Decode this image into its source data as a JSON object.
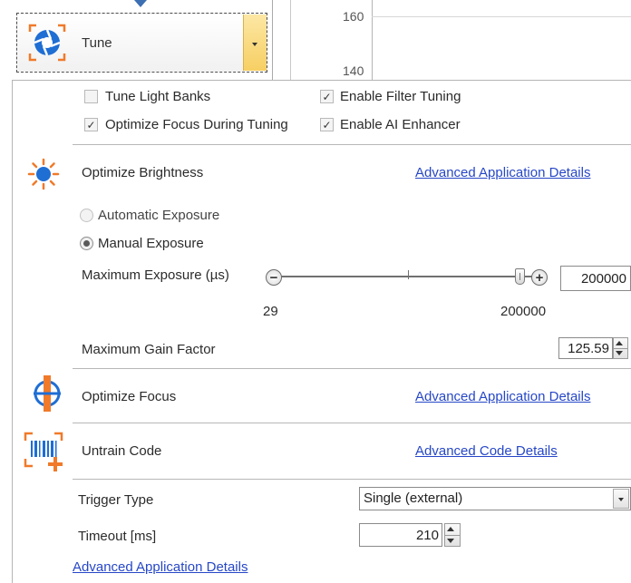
{
  "tune_button": {
    "label": "Tune",
    "icon": "tune-aperture-icon"
  },
  "background_chart": {
    "y_ticks": [
      "160",
      "140"
    ]
  },
  "options": {
    "tune_light_banks": {
      "label": "Tune Light Banks",
      "checked": false,
      "enabled": false
    },
    "enable_filter_tuning": {
      "label": "Enable Filter Tuning",
      "checked": true,
      "enabled": false
    },
    "optimize_focus_during_tuning": {
      "label": "Optimize Focus During Tuning",
      "checked": true,
      "enabled": false
    },
    "enable_ai_enhancer": {
      "label": "Enable AI Enhancer",
      "checked": true,
      "enabled": false
    }
  },
  "brightness": {
    "icon": "sun-brightness-icon",
    "title": "Optimize Brightness",
    "link": "Advanced Application Details",
    "automatic_exposure": "Automatic Exposure",
    "manual_exposure": "Manual Exposure",
    "selected": "Manual Exposure",
    "max_exposure_label": "Maximum Exposure (µs)",
    "max_exposure_value": "200000",
    "slider_min": "29",
    "slider_max": "200000",
    "max_gain_label": "Maximum Gain Factor",
    "max_gain_value": "125.59"
  },
  "focus": {
    "icon": "focus-crosshair-icon",
    "title": "Optimize Focus",
    "link": "Advanced Application Details"
  },
  "untrain": {
    "icon": "barcode-add-icon",
    "title": "Untrain Code",
    "link": "Advanced Code Details"
  },
  "trigger": {
    "type_label": "Trigger Type",
    "type_value": "Single (external)",
    "timeout_label": "Timeout [ms]",
    "timeout_value": "210"
  },
  "footer_link": "Advanced Application Details",
  "colors": {
    "link": "#2647c7",
    "icon_blue": "#1f6ed4",
    "icon_orange": "#f07a2a",
    "dropdown_yellow": "#f7cf63"
  }
}
